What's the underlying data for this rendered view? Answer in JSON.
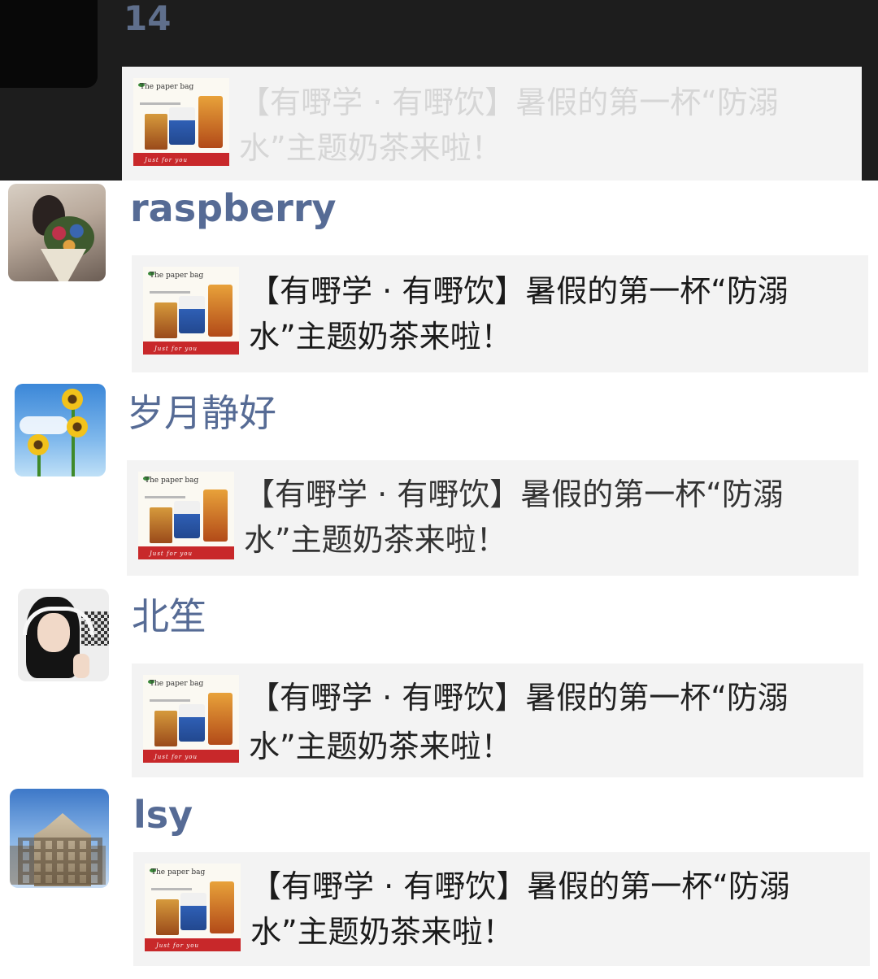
{
  "header_partial": {
    "name": "14"
  },
  "messages": [
    {
      "name": "raspberry",
      "avatar_icon": "bouquet-portrait-icon",
      "card_text": "【有嘢学 · 有嘢饮】暑假的第一杯“防溺水”主题奶茶来啦！"
    },
    {
      "name": "岁月静好",
      "avatar_icon": "sunflower-icon",
      "card_text": "【有嘢学 · 有嘢饮】暑假的第一杯“防溺水”主题奶茶来啦！"
    },
    {
      "name": "北笙",
      "avatar_icon": "girl-headphones-icon",
      "card_text": "【有嘢学 · 有嘢饮】暑假的第一杯“防溺水”主题奶茶来啦！"
    },
    {
      "name": "lsy",
      "avatar_icon": "building-icon",
      "card_text": "【有嘢学 · 有嘢饮】暑假的第一杯“防溺水”主题奶茶来啦！"
    }
  ],
  "dark_card_text": "【有嘢学 · 有嘢饮】暑假的第一杯“防溺水”主题奶茶来啦！",
  "thumbnail": {
    "title": "The paper bag",
    "band": "Just for you"
  },
  "colors": {
    "name": "#566b95",
    "card_bg": "#f3f3f3",
    "dark_bg": "#1d1d1d"
  }
}
